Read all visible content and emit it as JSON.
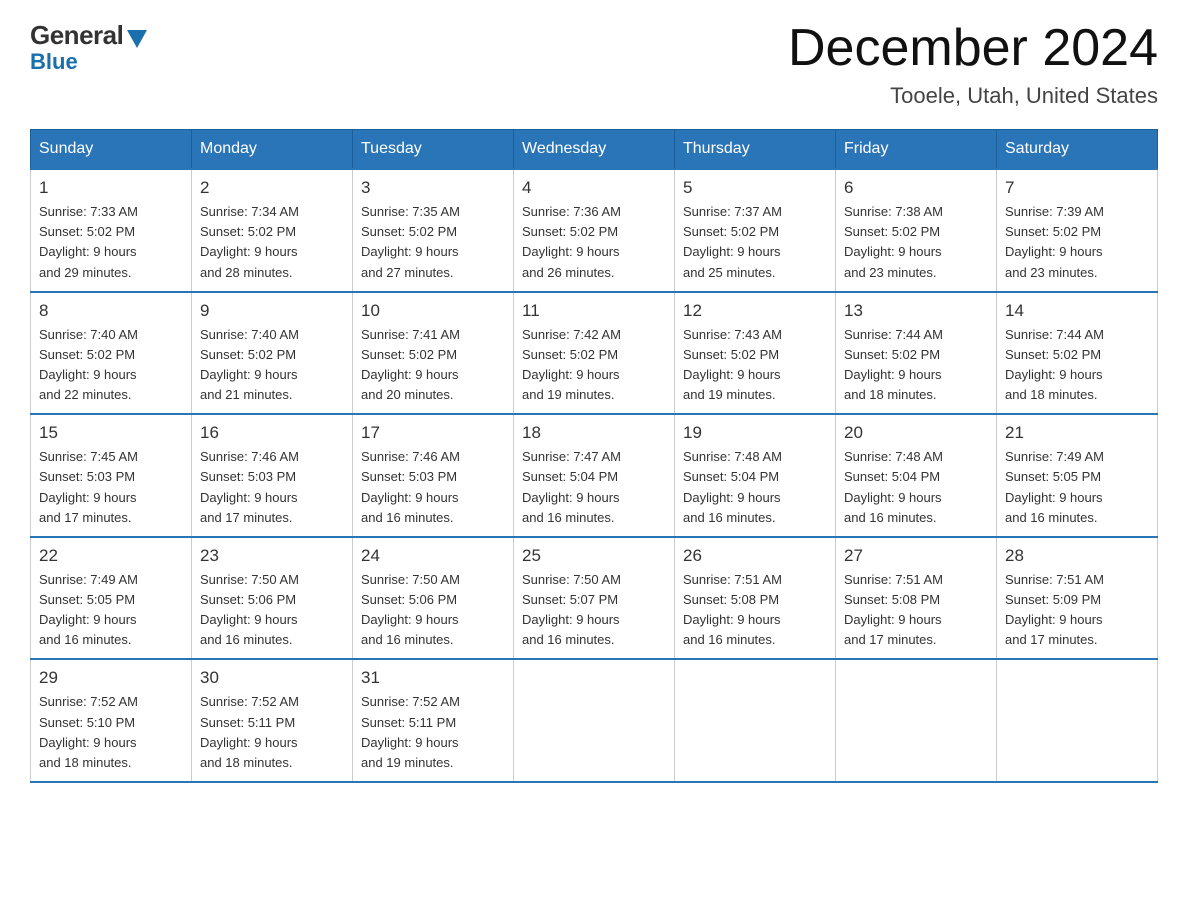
{
  "logo": {
    "general": "General",
    "blue": "Blue"
  },
  "title": "December 2024",
  "location": "Tooele, Utah, United States",
  "weekdays": [
    "Sunday",
    "Monday",
    "Tuesday",
    "Wednesday",
    "Thursday",
    "Friday",
    "Saturday"
  ],
  "weeks": [
    [
      {
        "day": "1",
        "sunrise": "7:33 AM",
        "sunset": "5:02 PM",
        "daylight": "9 hours and 29 minutes."
      },
      {
        "day": "2",
        "sunrise": "7:34 AM",
        "sunset": "5:02 PM",
        "daylight": "9 hours and 28 minutes."
      },
      {
        "day": "3",
        "sunrise": "7:35 AM",
        "sunset": "5:02 PM",
        "daylight": "9 hours and 27 minutes."
      },
      {
        "day": "4",
        "sunrise": "7:36 AM",
        "sunset": "5:02 PM",
        "daylight": "9 hours and 26 minutes."
      },
      {
        "day": "5",
        "sunrise": "7:37 AM",
        "sunset": "5:02 PM",
        "daylight": "9 hours and 25 minutes."
      },
      {
        "day": "6",
        "sunrise": "7:38 AM",
        "sunset": "5:02 PM",
        "daylight": "9 hours and 23 minutes."
      },
      {
        "day": "7",
        "sunrise": "7:39 AM",
        "sunset": "5:02 PM",
        "daylight": "9 hours and 23 minutes."
      }
    ],
    [
      {
        "day": "8",
        "sunrise": "7:40 AM",
        "sunset": "5:02 PM",
        "daylight": "9 hours and 22 minutes."
      },
      {
        "day": "9",
        "sunrise": "7:40 AM",
        "sunset": "5:02 PM",
        "daylight": "9 hours and 21 minutes."
      },
      {
        "day": "10",
        "sunrise": "7:41 AM",
        "sunset": "5:02 PM",
        "daylight": "9 hours and 20 minutes."
      },
      {
        "day": "11",
        "sunrise": "7:42 AM",
        "sunset": "5:02 PM",
        "daylight": "9 hours and 19 minutes."
      },
      {
        "day": "12",
        "sunrise": "7:43 AM",
        "sunset": "5:02 PM",
        "daylight": "9 hours and 19 minutes."
      },
      {
        "day": "13",
        "sunrise": "7:44 AM",
        "sunset": "5:02 PM",
        "daylight": "9 hours and 18 minutes."
      },
      {
        "day": "14",
        "sunrise": "7:44 AM",
        "sunset": "5:02 PM",
        "daylight": "9 hours and 18 minutes."
      }
    ],
    [
      {
        "day": "15",
        "sunrise": "7:45 AM",
        "sunset": "5:03 PM",
        "daylight": "9 hours and 17 minutes."
      },
      {
        "day": "16",
        "sunrise": "7:46 AM",
        "sunset": "5:03 PM",
        "daylight": "9 hours and 17 minutes."
      },
      {
        "day": "17",
        "sunrise": "7:46 AM",
        "sunset": "5:03 PM",
        "daylight": "9 hours and 16 minutes."
      },
      {
        "day": "18",
        "sunrise": "7:47 AM",
        "sunset": "5:04 PM",
        "daylight": "9 hours and 16 minutes."
      },
      {
        "day": "19",
        "sunrise": "7:48 AM",
        "sunset": "5:04 PM",
        "daylight": "9 hours and 16 minutes."
      },
      {
        "day": "20",
        "sunrise": "7:48 AM",
        "sunset": "5:04 PM",
        "daylight": "9 hours and 16 minutes."
      },
      {
        "day": "21",
        "sunrise": "7:49 AM",
        "sunset": "5:05 PM",
        "daylight": "9 hours and 16 minutes."
      }
    ],
    [
      {
        "day": "22",
        "sunrise": "7:49 AM",
        "sunset": "5:05 PM",
        "daylight": "9 hours and 16 minutes."
      },
      {
        "day": "23",
        "sunrise": "7:50 AM",
        "sunset": "5:06 PM",
        "daylight": "9 hours and 16 minutes."
      },
      {
        "day": "24",
        "sunrise": "7:50 AM",
        "sunset": "5:06 PM",
        "daylight": "9 hours and 16 minutes."
      },
      {
        "day": "25",
        "sunrise": "7:50 AM",
        "sunset": "5:07 PM",
        "daylight": "9 hours and 16 minutes."
      },
      {
        "day": "26",
        "sunrise": "7:51 AM",
        "sunset": "5:08 PM",
        "daylight": "9 hours and 16 minutes."
      },
      {
        "day": "27",
        "sunrise": "7:51 AM",
        "sunset": "5:08 PM",
        "daylight": "9 hours and 17 minutes."
      },
      {
        "day": "28",
        "sunrise": "7:51 AM",
        "sunset": "5:09 PM",
        "daylight": "9 hours and 17 minutes."
      }
    ],
    [
      {
        "day": "29",
        "sunrise": "7:52 AM",
        "sunset": "5:10 PM",
        "daylight": "9 hours and 18 minutes."
      },
      {
        "day": "30",
        "sunrise": "7:52 AM",
        "sunset": "5:11 PM",
        "daylight": "9 hours and 18 minutes."
      },
      {
        "day": "31",
        "sunrise": "7:52 AM",
        "sunset": "5:11 PM",
        "daylight": "9 hours and 19 minutes."
      },
      null,
      null,
      null,
      null
    ]
  ],
  "labels": {
    "sunrise": "Sunrise:",
    "sunset": "Sunset:",
    "daylight": "Daylight:"
  }
}
